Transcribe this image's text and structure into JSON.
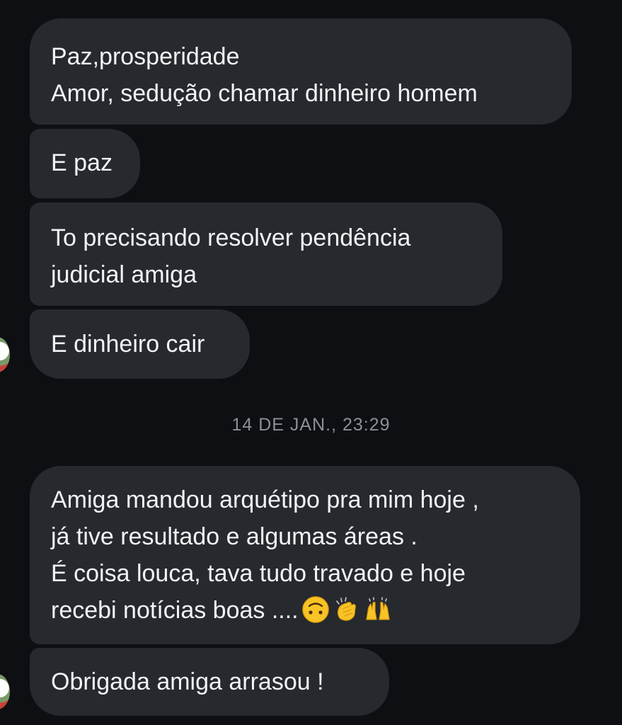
{
  "messages": [
    {
      "lines": [
        "Paz,prosperidade",
        "Amor, sedução chamar dinheiro homem"
      ]
    },
    {
      "lines": [
        "E paz"
      ]
    },
    {
      "lines": [
        "To precisando resolver pendência",
        "judicial amiga"
      ]
    },
    {
      "lines": [
        "E dinheiro cair"
      ]
    },
    {
      "lines": [
        "Amiga mandou arquétipo pra mim hoje ,",
        "já tive resultado e algumas áreas .",
        "É coisa louca, tava tudo travado e hoje",
        "recebi notícias boas ...."
      ]
    },
    {
      "lines": [
        "Obrigada amiga arrasou !"
      ]
    }
  ],
  "timestamp": "14 DE JAN., 23:29",
  "emojis": [
    "upside-down-face-icon",
    "clapping-hands-icon",
    "raising-hands-icon"
  ],
  "colors": {
    "background": "#0d0f12",
    "bubble": "#26292e",
    "text": "#f2f3f5",
    "timestamp": "#8b9096"
  }
}
